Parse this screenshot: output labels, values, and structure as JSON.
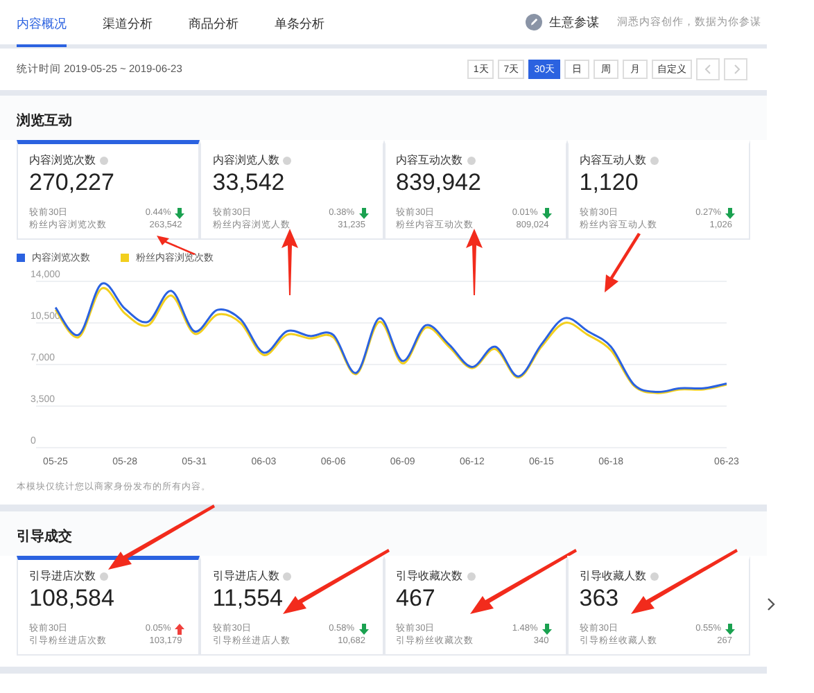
{
  "tabs": [
    {
      "label": "内容概况",
      "selected": true
    },
    {
      "label": "渠道分析",
      "selected": false
    },
    {
      "label": "商品分析",
      "selected": false
    },
    {
      "label": "单条分析",
      "selected": false
    }
  ],
  "advisor": {
    "label": "生意参谋",
    "hint": "洞悉内容创作，数据为你参谋"
  },
  "date_bar": {
    "range": "统计时间 2019-05-25 ~ 2019-06-23",
    "periods": [
      {
        "label": "1天",
        "selected": false
      },
      {
        "label": "7天",
        "selected": false
      },
      {
        "label": "30天",
        "selected": true
      },
      {
        "label": "日",
        "selected": false
      },
      {
        "label": "周",
        "selected": false
      },
      {
        "label": "月",
        "selected": false
      },
      {
        "label": "自定义",
        "selected": false
      }
    ],
    "prev_disabled": true,
    "next_disabled": true
  },
  "sections": [
    {
      "title": "浏览互动",
      "cards": [
        {
          "title": "内容浏览次数",
          "value": "270,227",
          "compare_label": "较前30日",
          "change": "0.44%",
          "fans_label": "粉丝内容浏览次数",
          "fans_value": "263,542",
          "rising": false,
          "selected": true,
          "marked": true
        },
        {
          "title": "内容浏览人数",
          "value": "33,542",
          "compare_label": "较前30日",
          "change": "0.38%",
          "fans_label": "粉丝内容浏览人数",
          "fans_value": "31,235",
          "rising": false,
          "selected": false,
          "marked": true
        },
        {
          "title": "内容互动次数",
          "value": "839,942",
          "compare_label": "较前30日",
          "change": "0.01%",
          "fans_label": "粉丝内容互动次数",
          "fans_value": "809,024",
          "rising": false,
          "selected": false,
          "marked": true
        },
        {
          "title": "内容互动人数",
          "value": "1,120",
          "compare_label": "较前30日",
          "change": "0.27%",
          "fans_label": "粉丝内容互动人数",
          "fans_value": "1,026",
          "rising": false,
          "selected": false,
          "marked": true
        }
      ],
      "chart_data": {
        "type": "line",
        "categories": [
          "05-25",
          null,
          null,
          "05-28",
          null,
          null,
          "05-31",
          null,
          null,
          "06-03",
          null,
          null,
          "06-06",
          null,
          null,
          "06-09",
          null,
          null,
          "06-12",
          null,
          null,
          "06-15",
          null,
          null,
          "06-18",
          null,
          null,
          null,
          null,
          "06-23"
        ],
        "grid": true,
        "series": [
          {
            "name": "内容浏览次数",
            "color": "#2b62e0",
            "values": [
              11800,
              9500,
              13800,
              11700,
              10600,
              13200,
              9800,
              11600,
              10800,
              8000,
              9800,
              9400,
              9500,
              6300,
              10900,
              7300,
              10300,
              8700,
              6800,
              8500,
              6000,
              8700,
              10900,
              9800,
              8500,
              5300,
              4700,
              5000,
              5000,
              5400
            ]
          },
          {
            "name": "粉丝内容浏览次数",
            "color": "#f2cf1e",
            "values": [
              11600,
              9300,
              13400,
              11300,
              10300,
              12800,
              9600,
              11200,
              10500,
              7800,
              9500,
              9200,
              9300,
              6200,
              10600,
              7100,
              10100,
              8500,
              6700,
              8300,
              5900,
              8500,
              10500,
              9500,
              8200,
              5200,
              4600,
              4900,
              4900,
              5300
            ]
          }
        ],
        "ylim": [
          0,
          14000
        ],
        "yticks": [
          0,
          {
            "value": 3500,
            "label": "3,500"
          },
          {
            "value": 7000,
            "label": "7,000"
          },
          {
            "value": 10500,
            "label": "10,500"
          },
          {
            "value": 14000,
            "label": "14,000"
          }
        ]
      },
      "note": "本模块仅统计您以商家身份发布的所有内容。"
    },
    {
      "title": "引导成交",
      "cards": [
        {
          "title": "引导进店次数",
          "value": "108,584",
          "compare_label": "较前30日",
          "change": "0.05%",
          "fans_label": "引导粉丝进店次数",
          "fans_value": "103,179",
          "rising": true,
          "selected": true,
          "marked": true
        },
        {
          "title": "引导进店人数",
          "value": "11,554",
          "compare_label": "较前30日",
          "change": "0.58%",
          "fans_label": "引导粉丝进店人数",
          "fans_value": "10,682",
          "rising": false,
          "selected": false,
          "marked": true
        },
        {
          "title": "引导收藏次数",
          "value": "467",
          "compare_label": "较前30日",
          "change": "1.48%",
          "fans_label": "引导粉丝收藏次数",
          "fans_value": "340",
          "rising": false,
          "selected": false,
          "marked": true
        },
        {
          "title": "引导收藏人数",
          "value": "363",
          "compare_label": "较前30日",
          "change": "0.55%",
          "fans_label": "引导粉丝收藏人数",
          "fans_value": "267",
          "rising": false,
          "selected": false,
          "marked": true
        }
      ],
      "has_next": true
    }
  ]
}
